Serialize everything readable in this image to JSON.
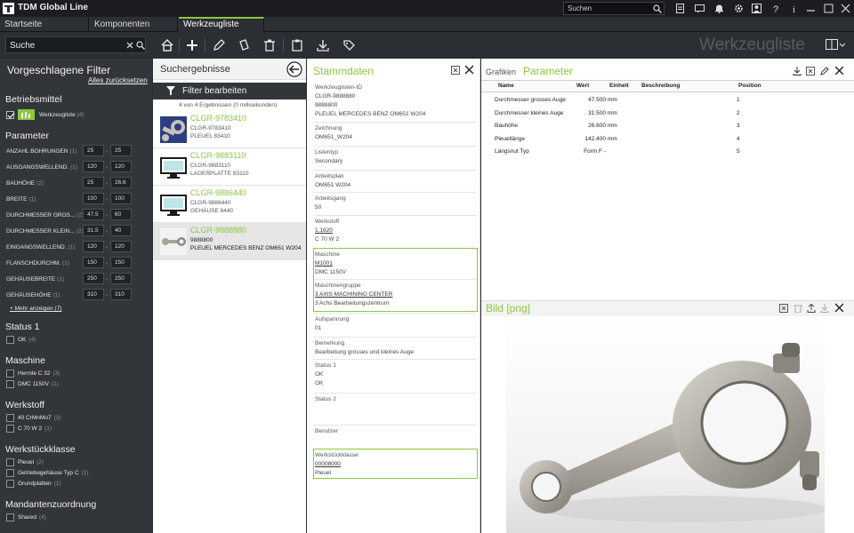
{
  "app": {
    "title": "TDM Global Line",
    "search_placeholder": "Suchen",
    "page_heading": "Werkzeugliste"
  },
  "tabs": [
    {
      "label": "Startseite"
    },
    {
      "label": "Komponenten"
    },
    {
      "label": "Werkzeugliste",
      "active": true
    }
  ],
  "filter": {
    "search_value": "Suche",
    "title": "Vorgeschlagene Filter",
    "reset": "Alles zurücksetzen",
    "betriebsmittel": {
      "title": "Betriebsmittel",
      "item": "Werkzeugliste",
      "count": "(4)"
    },
    "parameter": {
      "title": "Parameter",
      "rows": [
        {
          "label": "ANZAHL BOHRUNGEN",
          "count": "(1)",
          "from": "25",
          "to": "25"
        },
        {
          "label": "AUSGANGSWELLEND.",
          "count": "(1)",
          "from": "120",
          "to": "120"
        },
        {
          "label": "BAUHÖHE",
          "count": "(2)",
          "from": "25",
          "to": "26.6"
        },
        {
          "label": "BREITE",
          "count": "(1)",
          "from": "100",
          "to": "100"
        },
        {
          "label": "DURCHMESSER GROS...",
          "count": "(2)",
          "from": "47.5",
          "to": "60"
        },
        {
          "label": "DURCHMESSER KLEIN...",
          "count": "(2)",
          "from": "31.5",
          "to": "40"
        },
        {
          "label": "EINGANGSWELLEND.",
          "count": "(1)",
          "from": "120",
          "to": "120"
        },
        {
          "label": "FLANSCHDURCHM.",
          "count": "(1)",
          "from": "150",
          "to": "150"
        },
        {
          "label": "GEHÄUSEBREITE",
          "count": "(1)",
          "from": "250",
          "to": "250"
        },
        {
          "label": "GEHÄUSEHÖHE",
          "count": "(1)",
          "from": "310",
          "to": "310"
        }
      ],
      "more": "+  Mehr anzeigen (7)"
    },
    "groups": [
      {
        "title": "Status 1",
        "items": [
          {
            "label": "OK",
            "count": "(4)"
          }
        ]
      },
      {
        "title": "Maschine",
        "items": [
          {
            "label": "Hermle C 32",
            "count": "(3)"
          },
          {
            "label": "DMC 1150V",
            "count": "(1)"
          }
        ]
      },
      {
        "title": "Werkstoff",
        "items": [
          {
            "label": "40 CrMnMo7",
            "count": "(3)"
          },
          {
            "label": "C 70 W 2",
            "count": "(1)"
          }
        ]
      },
      {
        "title": "Werkstückklasse",
        "items": [
          {
            "label": "Pleuel",
            "count": "(2)"
          },
          {
            "label": "Getriebegehäuse Typ C",
            "count": "(1)"
          },
          {
            "label": "Grundplatten",
            "count": "(1)"
          }
        ]
      },
      {
        "title": "Mandantenzuordnung",
        "items": [
          {
            "label": "Shared",
            "count": "(4)"
          }
        ]
      }
    ]
  },
  "results": {
    "title": "Suchergebnisse",
    "edit_filter": "Filter bearbeiten",
    "summary": "4 von 4 Ergebnissen (0 millisekunden)",
    "items": [
      {
        "title": "CLGR-9783410",
        "line1": "CLGR-9783410",
        "line2": "PLEUEL 83410"
      },
      {
        "title": "CLGR-9883110",
        "line1": "CLGR-9883110",
        "line2": "LAGERPLATTE 83110"
      },
      {
        "title": "CLGR-9886440",
        "line1": "CLGR-9886440",
        "line2": "GEHÄUSE 6440"
      },
      {
        "title": "CLGR-9888880",
        "line1": "9888800",
        "line2": "PLEUEL MERCEDES BENZ OM651 W204"
      }
    ]
  },
  "stamm": {
    "title": "Stammdaten",
    "fields": [
      {
        "label": "Werkzeuglisten-ID",
        "values": [
          "CLGR-9888880",
          "9888800",
          "PLEUEL MERCEDES BENZ OM651 W204"
        ]
      },
      {
        "label": "Zeichnung",
        "values": [
          "OM651_W204"
        ]
      },
      {
        "label": "Listentyp",
        "values": [
          "Secondary"
        ]
      },
      {
        "label": "Arbeitsplan",
        "values": [
          "OM651 W204"
        ]
      },
      {
        "label": "Arbeitsgang",
        "values": [
          "50"
        ]
      },
      {
        "label": "Werkstoff",
        "values": [
          "1.1620",
          "C 70 W 2"
        ]
      },
      {
        "label": "Maschine",
        "values": [
          "M1001",
          "DMC 1150V"
        ]
      },
      {
        "label": "Maschinengruppe",
        "values": [
          "3 AXIS MACHINING CENTER",
          "3 Achs Bearbeitungszentrum"
        ]
      },
      {
        "label": "Aufspannung",
        "values": [
          "01"
        ]
      },
      {
        "label": "Bemerkung",
        "values": [
          "Bearbeitung grosses und kleines Auge"
        ]
      },
      {
        "label": "Status 1",
        "values": [
          "OK",
          "OK"
        ]
      },
      {
        "label": "Status 2",
        "values": []
      },
      {
        "label": "Benutzer",
        "values": []
      },
      {
        "label": "Werkstückklasse",
        "values": [
          "00008000",
          "Pleuel"
        ]
      }
    ]
  },
  "params": {
    "tab_grafiken": "Grafiken",
    "tab_parameter": "Parameter",
    "columns": [
      "Name",
      "Wert",
      "Einheit",
      "Beschreibung",
      "Position"
    ],
    "rows": [
      {
        "name": "Durchmesser grosses Auge",
        "wert": "47.500",
        "einheit": "mm",
        "beschreibung": "",
        "position": "1"
      },
      {
        "name": "Durchmesser kleines Auge",
        "wert": "31.500",
        "einheit": "mm",
        "beschreibung": "",
        "position": "2"
      },
      {
        "name": "Bauhöhe",
        "wert": "26.600",
        "einheit": "mm",
        "beschreibung": "",
        "position": "3"
      },
      {
        "name": "Pleuellänge",
        "wert": "142.400",
        "einheit": "mm",
        "beschreibung": "",
        "position": "4"
      },
      {
        "name": "Längsnut Typ",
        "wert": "Form F -",
        "einheit": "",
        "beschreibung": "",
        "position": "5"
      }
    ]
  },
  "bild": {
    "title": "Bild [png]"
  },
  "colors": {
    "accent": "#8cc63f",
    "dark_bg": "#2b2f33",
    "panel": "#32363b"
  }
}
